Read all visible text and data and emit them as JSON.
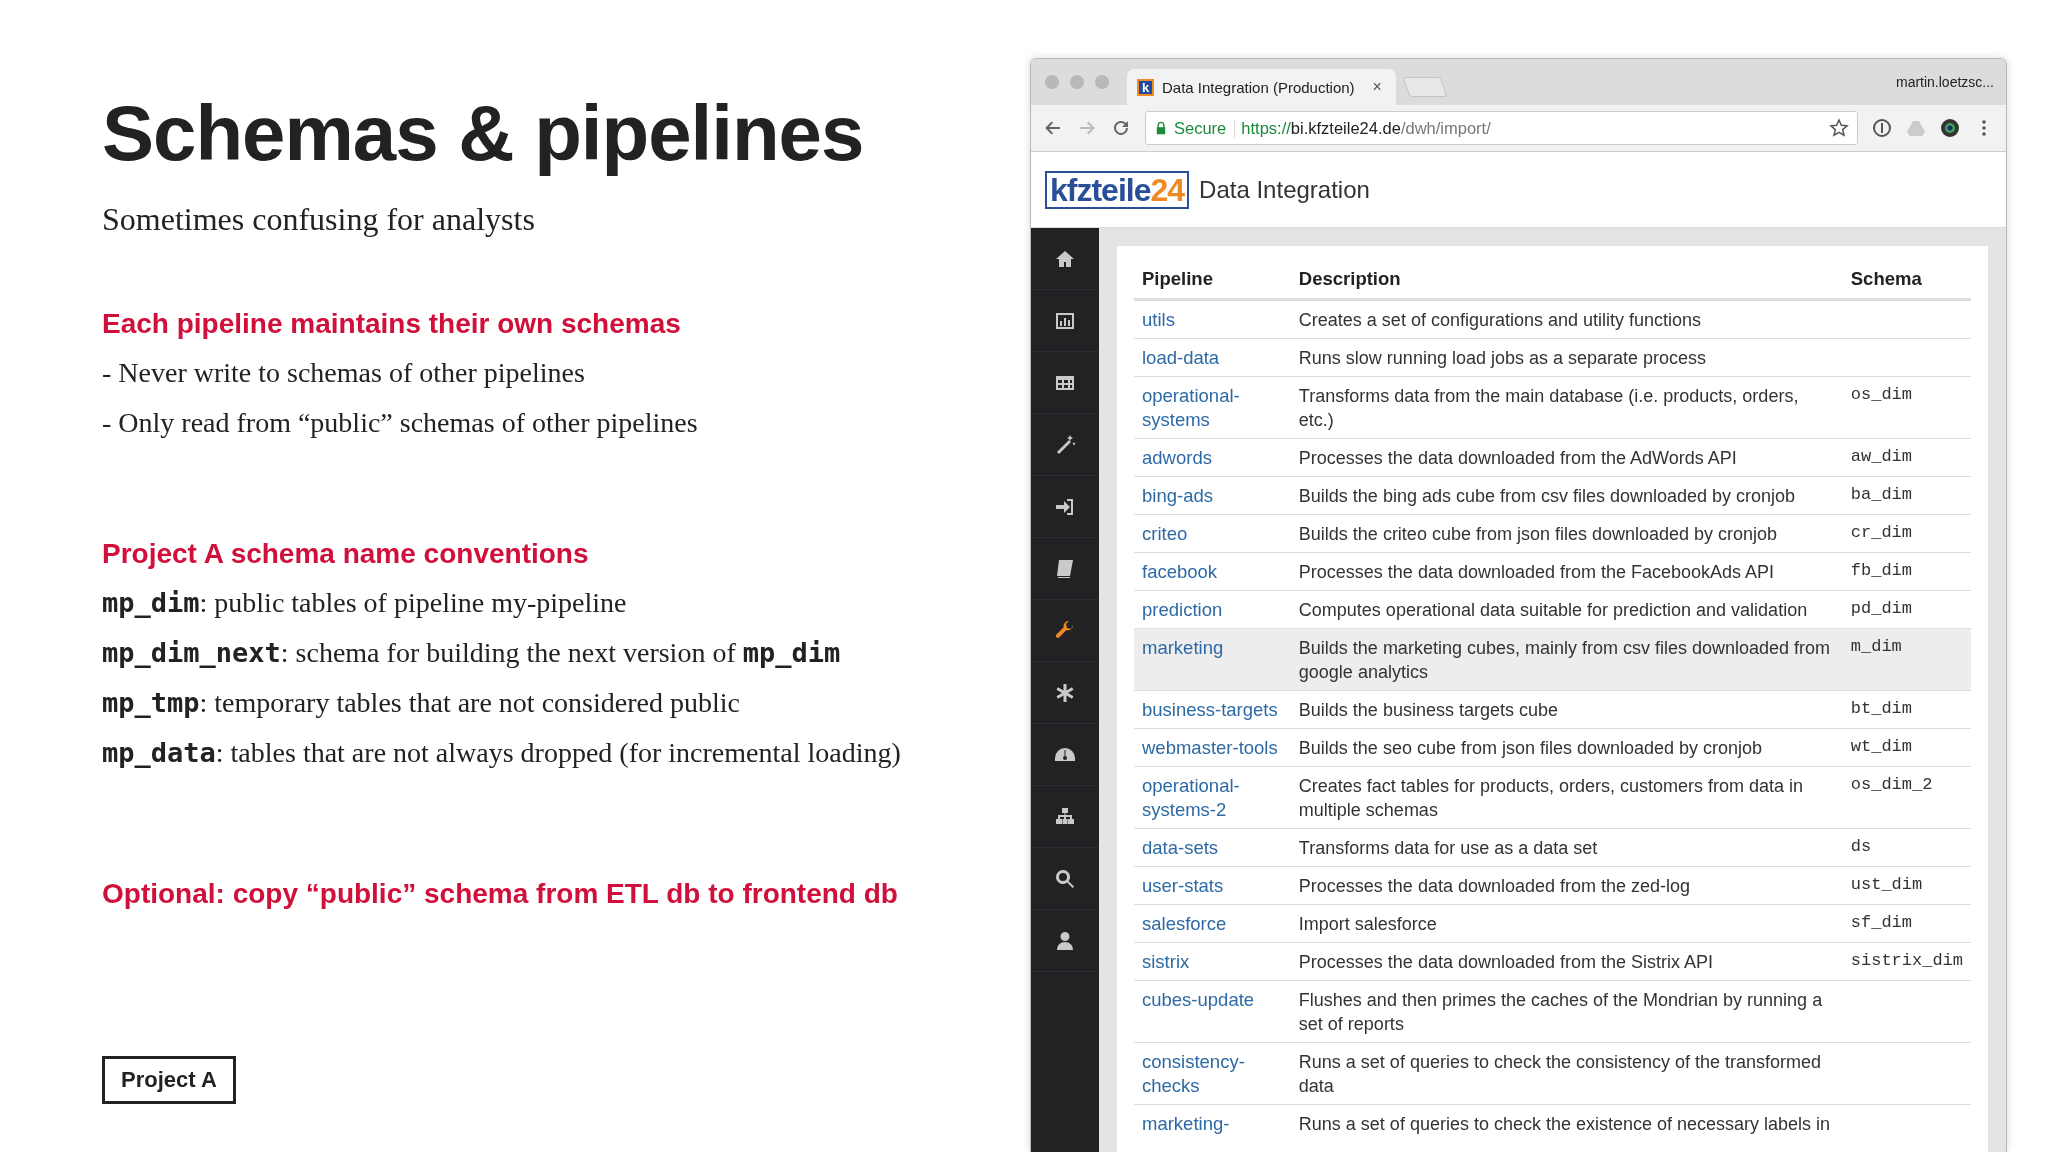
{
  "slide": {
    "title": "Schemas & pipelines",
    "subtitle": "Sometimes confusing for analysts",
    "sections": [
      {
        "heading": "Each pipeline maintains their own schemas",
        "lines": [
          [
            {
              "kind": "plain",
              "text": "- Never write to schemas of other pipelines"
            }
          ],
          [
            {
              "kind": "plain",
              "text": "- Only read from “public” schemas of other pipelines"
            }
          ]
        ]
      },
      {
        "heading": "Project A schema name conventions",
        "lines": [
          [
            {
              "kind": "code",
              "text": "mp_dim"
            },
            {
              "kind": "plain",
              "text": ":  public tables of pipeline my-pipeline"
            }
          ],
          [
            {
              "kind": "code",
              "text": "mp_dim_next"
            },
            {
              "kind": "plain",
              "text": ": schema for building the next version of "
            },
            {
              "kind": "code",
              "text": "mp_dim"
            }
          ],
          [
            {
              "kind": "code",
              "text": "mp_tmp"
            },
            {
              "kind": "plain",
              "text": ": temporary tables that are not considered public"
            }
          ],
          [
            {
              "kind": "code",
              "text": "mp_data"
            },
            {
              "kind": "plain",
              "text": ": tables that are not always dropped (for incremental loading)"
            }
          ]
        ]
      },
      {
        "heading": "Optional: copy “public” schema from ETL db to frontend db"
      }
    ],
    "footer_label": "Project A"
  },
  "browser": {
    "tab": {
      "favicon": "k",
      "title": "Data Integration (Production)",
      "close": "×"
    },
    "profile": "martin.loetzsc...",
    "address": {
      "secure_label": "Secure",
      "scheme": "https://",
      "host": "bi.kfzteile24.de",
      "path": "/dwh/import/"
    },
    "page": {
      "logo": {
        "main": "kfzteile",
        "accent": "24"
      },
      "title": "Data Integration",
      "sidebar": [
        {
          "selected": false
        },
        {
          "selected": false
        },
        {
          "selected": false
        },
        {
          "selected": false
        },
        {
          "selected": false
        },
        {
          "selected": false
        },
        {
          "selected": true
        },
        {
          "selected": false
        },
        {
          "selected": false
        },
        {
          "selected": false
        },
        {
          "selected": false
        },
        {
          "selected": false
        }
      ],
      "table": {
        "columns": [
          "Pipeline",
          "Description",
          "Schema"
        ],
        "rows": [
          {
            "pipeline": "utils",
            "description": "Creates a set of configurations and utility functions",
            "schema": "",
            "highlighted": false
          },
          {
            "pipeline": "load-data",
            "description": "Runs slow running load jobs as a separate process",
            "schema": "",
            "highlighted": false
          },
          {
            "pipeline": "operational-systems",
            "description": "Transforms data from the main database (i.e. products, orders, etc.)",
            "schema": "os_dim",
            "highlighted": false
          },
          {
            "pipeline": "adwords",
            "description": "Processes the data downloaded from the AdWords API",
            "schema": "aw_dim",
            "highlighted": false
          },
          {
            "pipeline": "bing-ads",
            "description": "Builds the bing ads cube from csv files downloaded by cronjob",
            "schema": "ba_dim",
            "highlighted": false
          },
          {
            "pipeline": "criteo",
            "description": "Builds the criteo cube from json files downloaded by cronjob",
            "schema": "cr_dim",
            "highlighted": false
          },
          {
            "pipeline": "facebook",
            "description": "Processes the data downloaded from the FacebookAds API",
            "schema": "fb_dim",
            "highlighted": false
          },
          {
            "pipeline": "prediction",
            "description": "Computes operational data suitable for prediction and validation",
            "schema": "pd_dim",
            "highlighted": false
          },
          {
            "pipeline": "marketing",
            "description": "Builds the marketing cubes, mainly from csv files downloaded from google analytics",
            "schema": "m_dim",
            "highlighted": true
          },
          {
            "pipeline": "business-targets",
            "description": "Builds the business targets cube",
            "schema": "bt_dim",
            "highlighted": false
          },
          {
            "pipeline": "webmaster-tools",
            "description": "Builds the seo cube from json files downloaded by cronjob",
            "schema": "wt_dim",
            "highlighted": false
          },
          {
            "pipeline": "operational-systems-2",
            "description": "Creates fact tables for products, orders, customers from data in multiple schemas",
            "schema": "os_dim_2",
            "highlighted": false
          },
          {
            "pipeline": "data-sets",
            "description": "Transforms data for use as a data set",
            "schema": "ds",
            "highlighted": false
          },
          {
            "pipeline": "user-stats",
            "description": "Processes the data downloaded from the zed-log",
            "schema": "ust_dim",
            "highlighted": false
          },
          {
            "pipeline": "salesforce",
            "description": "Import salesforce",
            "schema": "sf_dim",
            "highlighted": false
          },
          {
            "pipeline": "sistrix",
            "description": "Processes the data downloaded from the Sistrix API",
            "schema": "sistrix_dim",
            "highlighted": false
          },
          {
            "pipeline": "cubes-update",
            "description": "Flushes and then primes the caches of the Mondrian by running a set of reports",
            "schema": "",
            "highlighted": false
          },
          {
            "pipeline": "consistency-checks",
            "description": "Runs a set of queries to check the consistency of the transformed data",
            "schema": "",
            "highlighted": false
          },
          {
            "pipeline": "marketing-",
            "description": "Runs a set of queries to check the existence of necessary labels in",
            "schema": "",
            "highlighted": false
          }
        ]
      }
    }
  }
}
